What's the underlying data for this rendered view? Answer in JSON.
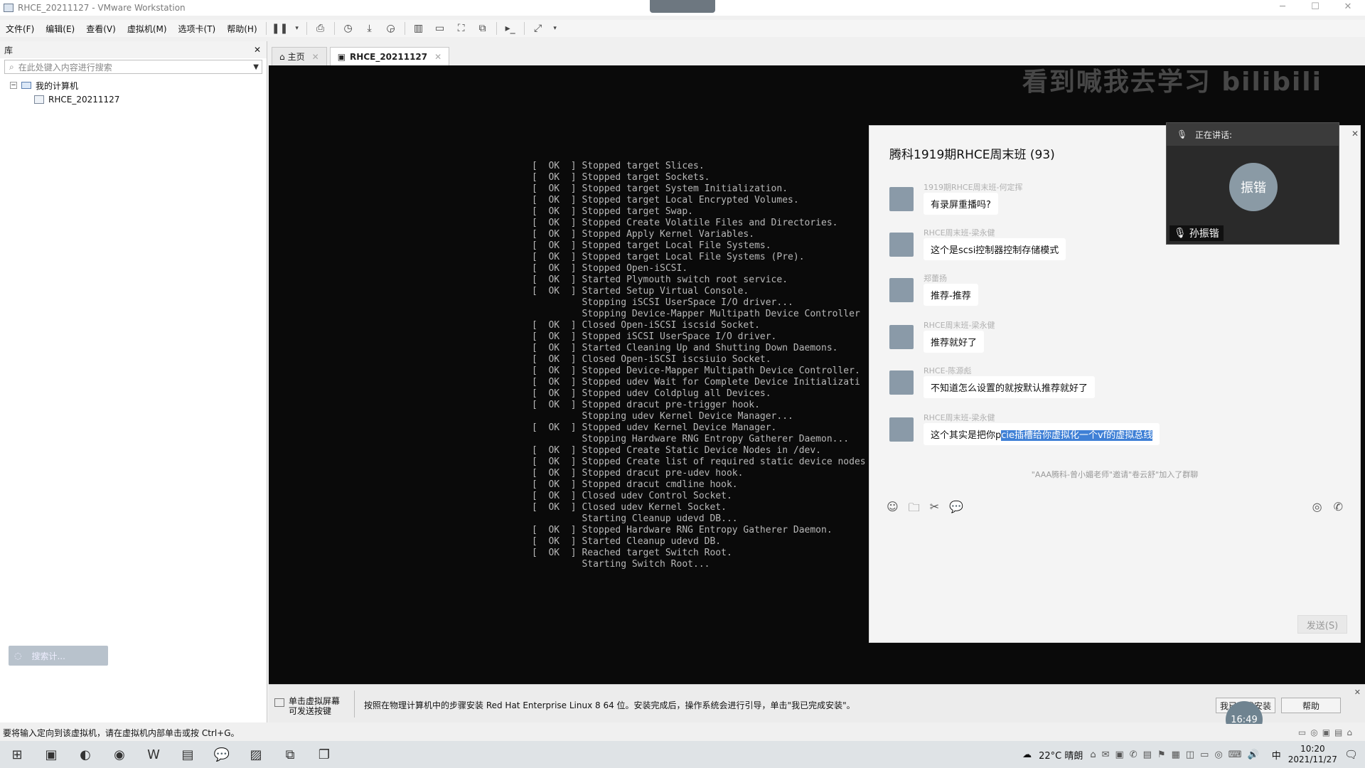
{
  "window": {
    "title": "RHCE_20211127 - VMware Workstation"
  },
  "menu": [
    "文件(F)",
    "编辑(E)",
    "查看(V)",
    "虚拟机(M)",
    "选项卡(T)",
    "帮助(H)"
  ],
  "library": {
    "header": "库",
    "search_placeholder": "在此处键入内容进行搜索",
    "root": "我的计算机",
    "vm": "RHCE_20211127",
    "bottom_button": "搜索计..."
  },
  "tabs": [
    {
      "label": "主页"
    },
    {
      "label": "RHCE_20211127"
    }
  ],
  "console_lines": [
    [
      "OK",
      "Stopped target Slices."
    ],
    [
      "OK",
      "Stopped target Sockets."
    ],
    [
      "OK",
      "Stopped target System Initialization."
    ],
    [
      "OK",
      "Stopped target Local Encrypted Volumes."
    ],
    [
      "OK",
      "Stopped target Swap."
    ],
    [
      "OK",
      "Stopped Create Volatile Files and Directories."
    ],
    [
      "OK",
      "Stopped Apply Kernel Variables."
    ],
    [
      "OK",
      "Stopped target Local File Systems."
    ],
    [
      "OK",
      "Stopped target Local File Systems (Pre)."
    ],
    [
      "OK",
      "Stopped Open-iSCSI."
    ],
    [
      "OK",
      "Started Plymouth switch root service."
    ],
    [
      "OK",
      "Started Setup Virtual Console."
    ],
    [
      "",
      "Stopping iSCSI UserSpace I/O driver..."
    ],
    [
      "",
      "Stopping Device-Mapper Multipath Device Controller"
    ],
    [
      "OK",
      "Closed Open-iSCSI iscsid Socket."
    ],
    [
      "OK",
      "Stopped iSCSI UserSpace I/O driver."
    ],
    [
      "OK",
      "Started Cleaning Up and Shutting Down Daemons."
    ],
    [
      "OK",
      "Closed Open-iSCSI iscsiuio Socket."
    ],
    [
      "OK",
      "Stopped Device-Mapper Multipath Device Controller."
    ],
    [
      "OK",
      "Stopped udev Wait for Complete Device Initializati"
    ],
    [
      "OK",
      "Stopped udev Coldplug all Devices."
    ],
    [
      "OK",
      "Stopped dracut pre-trigger hook."
    ],
    [
      "",
      "Stopping udev Kernel Device Manager..."
    ],
    [
      "OK",
      "Stopped udev Kernel Device Manager."
    ],
    [
      "",
      "Stopping Hardware RNG Entropy Gatherer Daemon..."
    ],
    [
      "OK",
      "Stopped Create Static Device Nodes in /dev."
    ],
    [
      "OK",
      "Stopped Create list of required static device nodes"
    ],
    [
      "OK",
      "Stopped dracut pre-udev hook."
    ],
    [
      "OK",
      "Stopped dracut cmdline hook."
    ],
    [
      "OK",
      "Closed udev Control Socket."
    ],
    [
      "OK",
      "Closed udev Kernel Socket."
    ],
    [
      "",
      "Starting Cleanup udevd DB..."
    ],
    [
      "OK",
      "Stopped Hardware RNG Entropy Gatherer Daemon."
    ],
    [
      "OK",
      "Started Cleanup udevd DB."
    ],
    [
      "OK",
      "Reached target Switch Root."
    ],
    [
      "",
      "Starting Switch Root..."
    ]
  ],
  "watermark": "看到喊我去学习 bilibili",
  "chat": {
    "title": "腾科1919期RHCE周末班 (93)",
    "messages": [
      {
        "sender": "1919期RHCE周末班-何定挥",
        "text": "有录屏重播吗?"
      },
      {
        "sender": "RHCE周末班-梁永健",
        "text": "这个是scsi控制器控制存储模式"
      },
      {
        "sender": "郑蕾扬",
        "text": "推荐-推荐"
      },
      {
        "sender": "RHCE周末班-梁永健",
        "text": "推荐就好了"
      },
      {
        "sender": "RHCE-陈源彪",
        "text": "不知道怎么设置的就按默认推荐就好了"
      },
      {
        "sender": "RHCE周末班-梁永健",
        "text_plain": "这个其实是把你p",
        "text_highlight": "cie插槽给你虚拟化一个vf的虚拟总线"
      }
    ],
    "system_note": "\"AAA腾科-曾小媚老师\"邀请\"卷云舒\"加入了群聊",
    "send_button": "发送(S)"
  },
  "speaking": {
    "header": "正在讲话:",
    "avatar_text": "振锴",
    "name": "孙振锴"
  },
  "hint": {
    "left": "单击虚拟屏幕\n可发送按键",
    "text": "按照在物理计算机中的步骤安装 Red Hat Enterprise Linux 8 64 位。安装完成后，操作系统会进行引导，单击\"我已完成安装\"。",
    "done_button": "我已完成安装",
    "help_button": "帮助"
  },
  "timer": "16:49",
  "statusbar": "要将输入定向到该虚拟机，请在虚拟机内部单击或按 Ctrl+G。",
  "taskbar": {
    "weather": "22°C 晴朗",
    "ime": "中",
    "time": "10:20",
    "date": "2021/11/27"
  }
}
